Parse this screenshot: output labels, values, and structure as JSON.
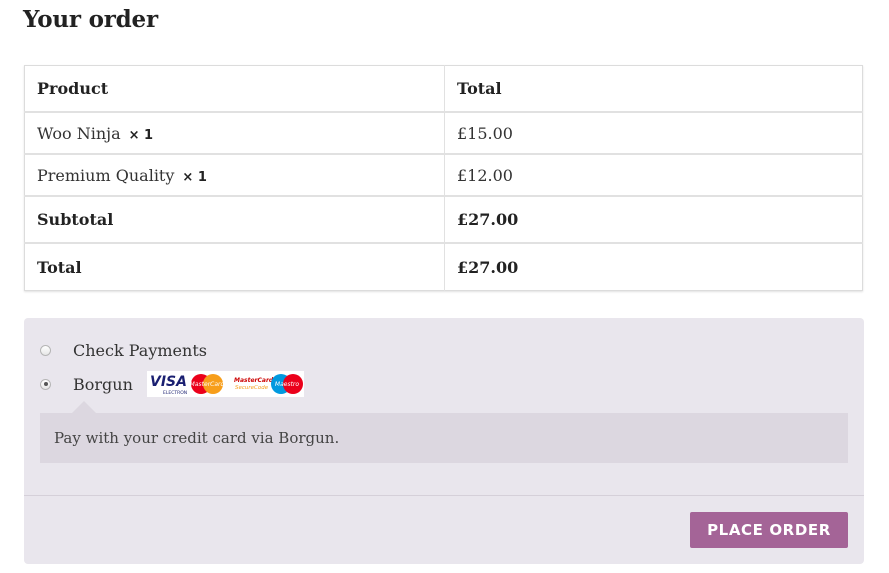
{
  "title": "Your order",
  "table": {
    "headers": {
      "product": "Product",
      "total": "Total"
    },
    "items": [
      {
        "name": "Woo Ninja",
        "qty": "× 1",
        "total": "£15.00"
      },
      {
        "name": "Premium Quality",
        "qty": "× 1",
        "total": "£12.00"
      }
    ],
    "subtotal": {
      "label": "Subtotal",
      "value": "£27.00"
    },
    "total": {
      "label": "Total",
      "value": "£27.00"
    }
  },
  "payment": {
    "methods": [
      {
        "label": "Check Payments",
        "selected": false
      },
      {
        "label": "Borgun",
        "selected": true,
        "card_icons": [
          "visa-electron-icon",
          "mastercard-icon",
          "mastercard-securecode-icon",
          "maestro-icon"
        ]
      }
    ],
    "cards": {
      "visa": "VISA",
      "electron": "ELECTRON",
      "mastercard": "MasterCard",
      "securecode_top": "MasterCard",
      "securecode_bottom": "SecureCode",
      "maestro": "Maestro"
    },
    "description": "Pay with your credit card via Borgun.",
    "place_order": "PLACE ORDER"
  },
  "colors": {
    "button": "#a46497",
    "payment_bg": "#e9e6ed",
    "description_bg": "#dcd7e0",
    "visa_blue": "#1a1f71",
    "mastercard_red": "#eb001b",
    "mastercard_orange": "#f79e1b",
    "maestro_blue": "#0099df"
  }
}
